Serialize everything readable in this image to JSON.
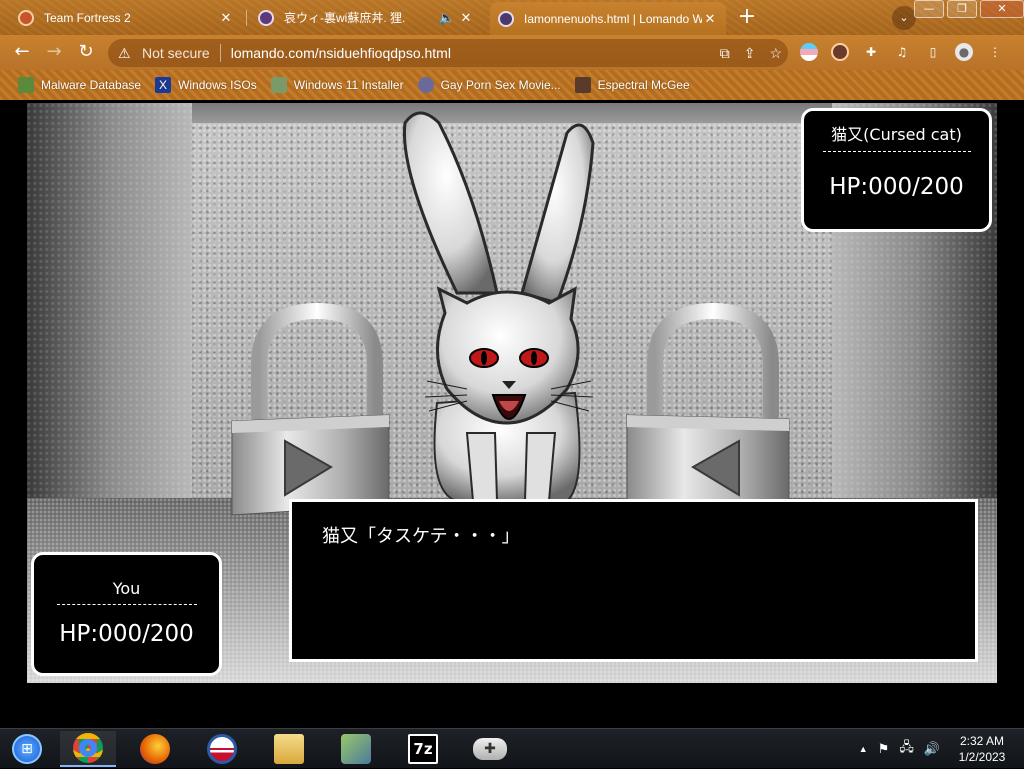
{
  "browser": {
    "tabs": [
      {
        "title": "Team Fortress 2",
        "close": "✕",
        "favicon_color": "#c8552a"
      },
      {
        "title": "哀ウィ-裏wi蘇庶丼. 狸.",
        "close": "✕",
        "favicon_color": "#5a3a7a",
        "muted_icon": "🔈"
      },
      {
        "title": "Iamonnenuohs.html | Lomando W",
        "close": "✕",
        "favicon_color": "#4a3a6a",
        "active": true
      }
    ],
    "new_tab": "+",
    "tab_search": "⌄",
    "window_buttons": {
      "minimize": "—",
      "restore": "❐",
      "close": "✕"
    },
    "nav": {
      "back": "←",
      "forward": "→",
      "reload": "↻"
    },
    "omnibox": {
      "security_icon": "warning-triangle-icon",
      "security_text": "Not secure",
      "url": "lomando.com/nsiduehfioqdpso.html"
    },
    "bookmarks": [
      {
        "label": "Malware Database",
        "icon_color": "#5a8a3a"
      },
      {
        "label": "Windows ISOs",
        "icon_color": "#1a3a9a",
        "glyph": "X"
      },
      {
        "label": "Windows 11 Installer",
        "icon_color": "#7a9a6a"
      },
      {
        "label": "Gay Porn Sex Movie...",
        "icon_color": "#6a6a9a"
      },
      {
        "label": "Espectral McGee",
        "icon_color": "#5a3a2a"
      }
    ]
  },
  "game": {
    "enemy": {
      "name": "猫又(Cursed cat)",
      "hp": "HP:000/200"
    },
    "player": {
      "name": "You",
      "hp": "HP:000/200"
    },
    "dialog": "猫又「タスケテ・・・」"
  },
  "taskbar": {
    "apps": [
      {
        "name": "start",
        "color": "#1e7ad6"
      },
      {
        "name": "chrome",
        "color": "#db4437"
      },
      {
        "name": "firefox",
        "color": "#e66000"
      },
      {
        "name": "obama-logo",
        "color": "#2a5aa8"
      },
      {
        "name": "file-explorer",
        "color": "#e8c060"
      },
      {
        "name": "network-app",
        "color": "#6a9a4a"
      },
      {
        "name": "7zip",
        "color": "#000000",
        "glyph": "7z"
      },
      {
        "name": "gamepad",
        "color": "#d0d0d0"
      }
    ],
    "tray": {
      "chevron": "▲",
      "flag": "⚑",
      "network": "🖧",
      "volume": "🔊"
    },
    "clock": {
      "time": "2:32 AM",
      "date": "1/2/2023"
    }
  }
}
